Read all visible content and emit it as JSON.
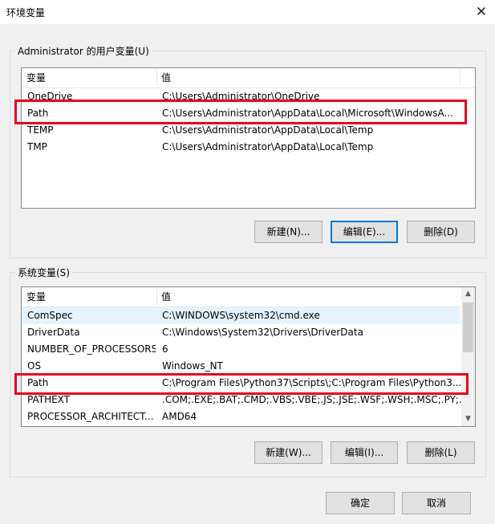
{
  "window": {
    "title": "环境变量",
    "close_glyph": "✕"
  },
  "user_vars": {
    "group_label": "Administrator 的用户变量(U)",
    "col_variable": "变量",
    "col_value": "值",
    "rows": [
      {
        "name": "OneDrive",
        "value": "C:\\Users\\Administrator\\OneDrive"
      },
      {
        "name": "Path",
        "value": "C:\\Users\\Administrator\\AppData\\Local\\Microsoft\\WindowsA..."
      },
      {
        "name": "TEMP",
        "value": "C:\\Users\\Administrator\\AppData\\Local\\Temp"
      },
      {
        "name": "TMP",
        "value": "C:\\Users\\Administrator\\AppData\\Local\\Temp"
      }
    ],
    "new_label": "新建(N)...",
    "edit_label": "编辑(E)...",
    "delete_label": "删除(D)"
  },
  "system_vars": {
    "group_label": "系统变量(S)",
    "col_variable": "变量",
    "col_value": "值",
    "rows": [
      {
        "name": "ComSpec",
        "value": "C:\\WINDOWS\\system32\\cmd.exe"
      },
      {
        "name": "DriverData",
        "value": "C:\\Windows\\System32\\Drivers\\DriverData"
      },
      {
        "name": "NUMBER_OF_PROCESSORS",
        "value": "6"
      },
      {
        "name": "OS",
        "value": "Windows_NT"
      },
      {
        "name": "Path",
        "value": "C:\\Program Files\\Python37\\Scripts\\;C:\\Program Files\\Python3..."
      },
      {
        "name": "PATHEXT",
        "value": ".COM;.EXE;.BAT;.CMD;.VBS;.VBE;.JS;.JSE;.WSF;.WSH;.MSC;.PY;.P..."
      },
      {
        "name": "PROCESSOR_ARCHITECT...",
        "value": "AMD64"
      }
    ],
    "new_label": "新建(W)...",
    "edit_label": "编辑(I)...",
    "delete_label": "删除(L)"
  },
  "footer": {
    "ok_label": "确定",
    "cancel_label": "取消"
  },
  "colors": {
    "highlight": "#e8001c",
    "selection": "#e5f3ff"
  }
}
